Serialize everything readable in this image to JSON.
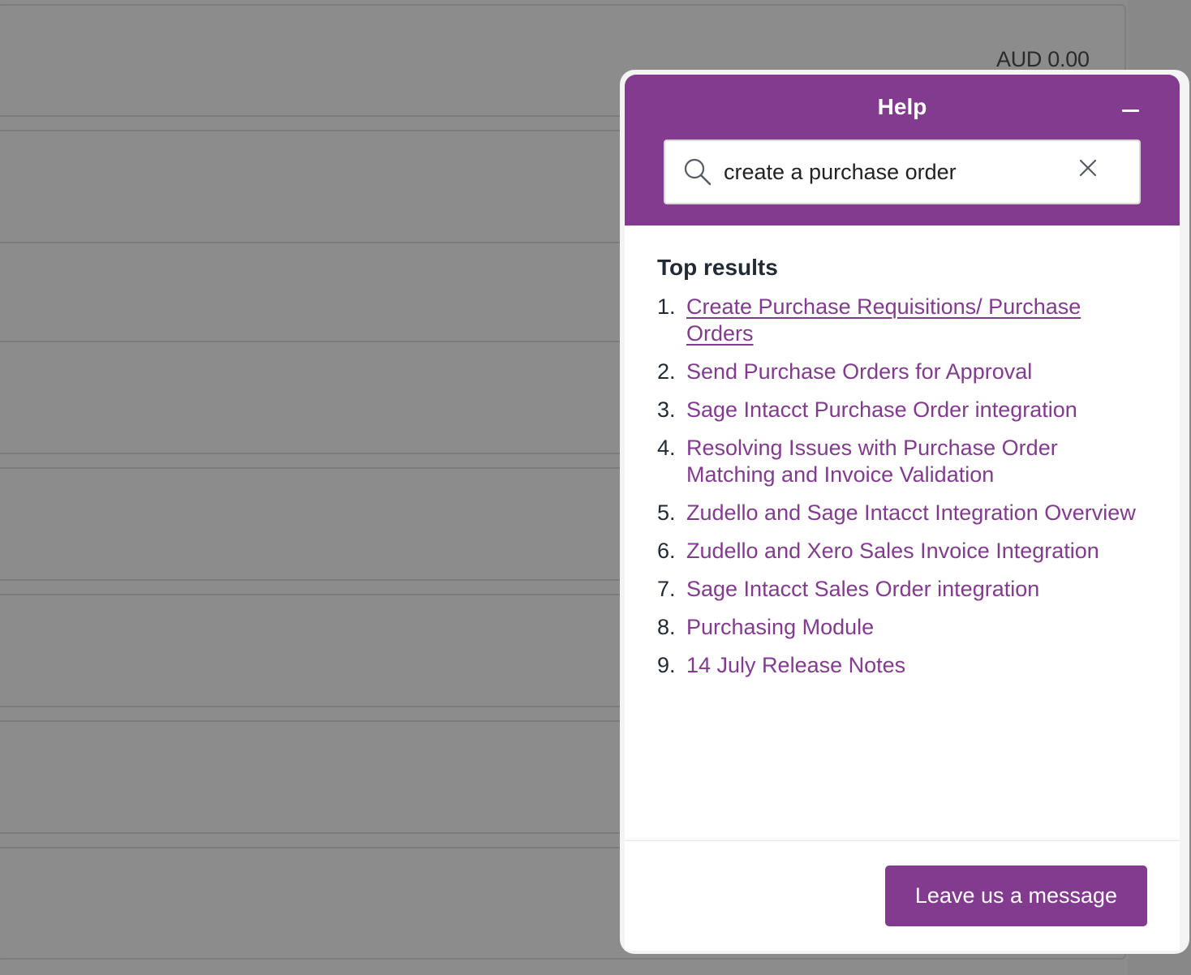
{
  "background": {
    "amount": "AUD 0.00"
  },
  "help": {
    "title": "Help",
    "minimize_label": "Minimize",
    "search": {
      "value": "create a purchase order",
      "icon": "search-icon",
      "clear_icon": "close-icon"
    },
    "results_heading": "Top results",
    "results": [
      {
        "num": "1.",
        "title": "Create Purchase Requisitions/ Purchase Orders",
        "underlined": true
      },
      {
        "num": "2.",
        "title": "Send Purchase Orders for Approval"
      },
      {
        "num": "3.",
        "title": "Sage Intacct Purchase Order integration"
      },
      {
        "num": "4.",
        "title": "Resolving Issues with Purchase Order Matching and Invoice Validation"
      },
      {
        "num": "5.",
        "title": "Zudello and Sage Intacct Integration Overview"
      },
      {
        "num": "6.",
        "title": "Zudello and Xero Sales Invoice Integration"
      },
      {
        "num": "7.",
        "title": "Sage Intacct Sales Order integration"
      },
      {
        "num": "8.",
        "title": "Purchasing Module"
      },
      {
        "num": "9.",
        "title": "14 July Release Notes"
      }
    ],
    "footer": {
      "leave_message_label": "Leave us a message"
    },
    "colors": {
      "brand": "#823b8e",
      "link": "#823b8e",
      "overlay": "#8c8c8c"
    }
  }
}
